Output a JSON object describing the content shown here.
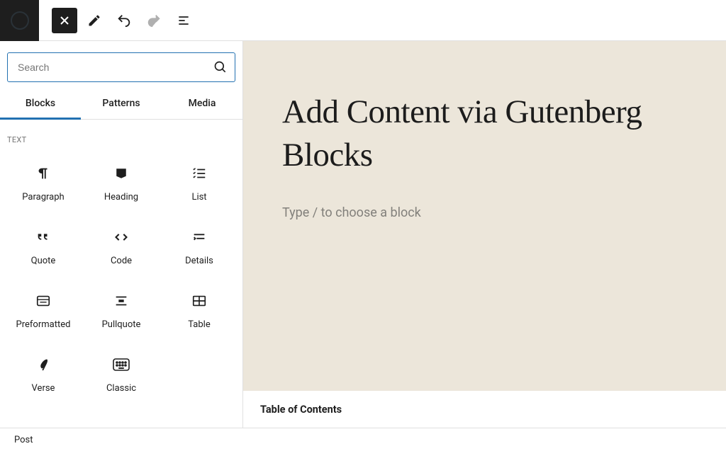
{
  "toolbar": {
    "close_label": "Close inserter",
    "edit_label": "Tools",
    "undo_label": "Undo",
    "redo_label": "Redo",
    "document_overview_label": "Document Overview"
  },
  "sidebar": {
    "search_placeholder": "Search",
    "tabs": [
      {
        "label": "Blocks",
        "active": true
      },
      {
        "label": "Patterns",
        "active": false
      },
      {
        "label": "Media",
        "active": false
      }
    ],
    "category_label": "TEXT",
    "blocks": [
      {
        "name": "paragraph",
        "label": "Paragraph"
      },
      {
        "name": "heading",
        "label": "Heading"
      },
      {
        "name": "list",
        "label": "List"
      },
      {
        "name": "quote",
        "label": "Quote"
      },
      {
        "name": "code",
        "label": "Code"
      },
      {
        "name": "details",
        "label": "Details"
      },
      {
        "name": "preformatted",
        "label": "Preformatted"
      },
      {
        "name": "pullquote",
        "label": "Pullquote"
      },
      {
        "name": "table",
        "label": "Table"
      },
      {
        "name": "verse",
        "label": "Verse"
      },
      {
        "name": "classic",
        "label": "Classic"
      }
    ]
  },
  "editor": {
    "title": "Add Content via Gutenberg Blocks",
    "placeholder": "Type / to choose a block",
    "toc_label": "Table of Contents"
  },
  "footer": {
    "breadcrumb": "Post"
  }
}
